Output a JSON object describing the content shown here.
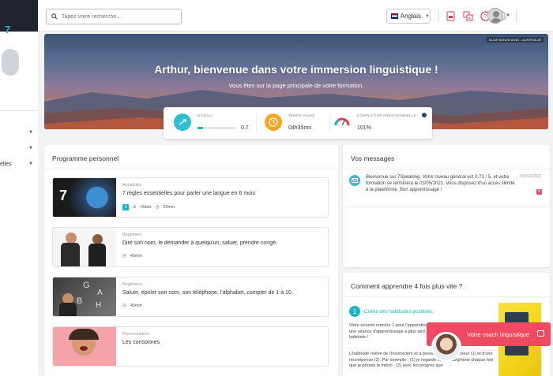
{
  "colors": {
    "accent": "#19b5c6",
    "coach": "#ef4a62",
    "sidebar_dark": "#1f2430"
  },
  "sidebar": {
    "brand_icon": "7-logo-fragment",
    "items": [
      {
        "label": ""
      },
      {
        "label": ""
      },
      {
        "label": "elles"
      }
    ]
  },
  "header": {
    "search_placeholder": "Tapez votre recherche...",
    "language": "Anglais",
    "icons": [
      "document-icon",
      "translate-icon",
      "help-icon",
      "notification-bell-icon"
    ]
  },
  "hero": {
    "credit": "BLUE MOUNTAINS - AUSTRALIE",
    "title": "Arthur, bienvenue dans votre immersion linguistique !",
    "subtitle": "Vous êtes sur la page principale de votre formation.",
    "stats": {
      "niveau_label": "NIVEAU",
      "niveau_value": "0.7",
      "niveau_progress": 0.146,
      "temps_label": "TEMPS PASSÉ",
      "temps_value": "04h35mn",
      "completion_label": "COMPLÉTION PRÉVISIONNELLE",
      "completion_value": "101%"
    }
  },
  "programme": {
    "title": "Programme personnel",
    "items": [
      {
        "category": "Actualités",
        "title": "7 règles essentielles pour parler une langue en 6 mois",
        "badge": "3",
        "type": "Vidéo",
        "duration": "20min"
      },
      {
        "category": "Beginners",
        "title": "Dire son nom, le demander à quelqu'un, saluer, prendre congé.",
        "duration": "45min"
      },
      {
        "category": "Beginners",
        "title": "Saluer, épeler son nom, son téléphone, l'alphabet, compter de 1 à 10.",
        "duration": "45min"
      },
      {
        "category": "Prononciation",
        "title": "Les consonnes"
      }
    ]
  },
  "messages": {
    "title": "Vos messages",
    "items": [
      {
        "text": "Bienvenue sur 7Speaking. Votre niveau général est 0.73 / 5, et votre formation se terminera le 03/05/2021. Vous disposez d'un accès illimité à la plateforme. Bon apprentissage !",
        "date": "01/02/2021"
      }
    ]
  },
  "tips": {
    "title": "Comment apprendre 4 fois plus vite ?",
    "number": "1",
    "subtitle": "Créez des habitudes positives",
    "p1": "Votre ennemi numéro 1 pour l'apprentissage d'une langue c'est de reporter une séance d'apprentissage à plus tard. Pour éviter cela, il suffit de créer une habitude !",
    "p2": "L'habitude relève de l'inconscient et a besoin d'un déclencheur (1) et d'une récompense (2). Par exemple : (1) je regarde mon smartphone chaque fois que je prends le métro ; (2) avec les progrès que"
  },
  "coach": {
    "label": "Votre coach linguistique"
  }
}
